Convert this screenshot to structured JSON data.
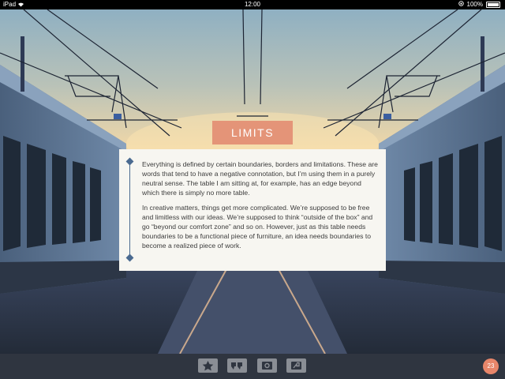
{
  "status_bar": {
    "device": "iPad",
    "time": "12:00",
    "battery": "100%",
    "icons": [
      "wifi-icon",
      "orientation-lock-icon",
      "battery-icon"
    ]
  },
  "article": {
    "title": "LIMITS",
    "paragraphs": [
      "Everything is defined by certain boundaries, borders and limitations. These are words that tend to have a negative connotation, but I’m using them in a purely neutral sense. The table I am sitting at, for example, has an edge beyond which there is simply no more table.",
      "In creative matters, things get more complicated. We’re supposed to be free and limitless with our ideas. We’re supposed to think “outside of the box” and go “beyond our comfort zone” and so on. However, just as this table needs boundaries to be a functional piece of furniture, an idea needs boundaries to become a realized piece of work."
    ]
  },
  "toolbar": {
    "buttons": [
      "star-icon",
      "quote-icon",
      "camera-icon",
      "share-icon"
    ],
    "page_count": "23"
  },
  "colors": {
    "accent": "#e49478",
    "rule": "#4a6a90",
    "card": "#f7f6f1",
    "toolbar": "#2f3540"
  }
}
